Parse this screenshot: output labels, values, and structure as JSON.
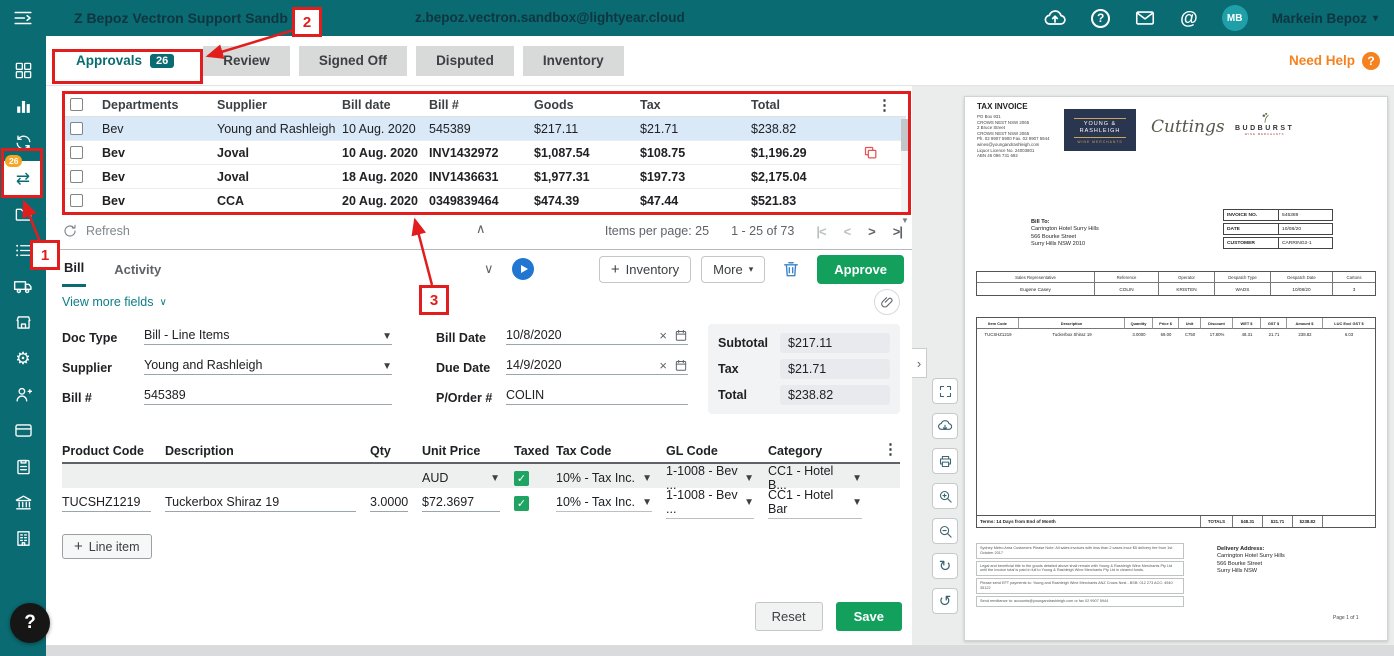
{
  "topbar": {
    "company": "Z Bepoz Vectron Support Sandb",
    "email": "z.bepoz.vectron.sandbox@lightyear.cloud",
    "user_initials": "MB",
    "user_name": "Markein Bepoz"
  },
  "sidebar": {
    "bills_badge": "26"
  },
  "tabs": {
    "approvals": "Approvals",
    "approvals_badge": "26",
    "review": "Review",
    "signed_off": "Signed Off",
    "disputed": "Disputed",
    "inventory": "Inventory",
    "need_help": "Need Help"
  },
  "bills": {
    "headers": {
      "departments": "Departments",
      "supplier": "Supplier",
      "bill_date": "Bill date",
      "bill_no": "Bill #",
      "goods": "Goods",
      "tax": "Tax",
      "total": "Total"
    },
    "rows": [
      {
        "department": "Bev",
        "supplier": "Young and Rashleigh",
        "bill_date": "10 Aug. 2020",
        "bill_no": "545389",
        "goods": "$217.11",
        "tax": "$21.71",
        "total": "$238.82"
      },
      {
        "department": "Bev",
        "supplier": "Joval",
        "bill_date": "10 Aug. 2020",
        "bill_no": "INV1432972",
        "goods": "$1,087.54",
        "tax": "$108.75",
        "total": "$1,196.29"
      },
      {
        "department": "Bev",
        "supplier": "Joval",
        "bill_date": "18 Aug. 2020",
        "bill_no": "INV1436631",
        "goods": "$1,977.31",
        "tax": "$197.73",
        "total": "$2,175.04"
      },
      {
        "department": "Bev",
        "supplier": "CCA",
        "bill_date": "20 Aug. 2020",
        "bill_no": "0349839464",
        "goods": "$474.39",
        "tax": "$47.44",
        "total": "$521.83"
      }
    ],
    "footer": {
      "refresh": "Refresh",
      "items_per_page": "Items per page: 25",
      "range": "1 - 25 of 73"
    }
  },
  "detail": {
    "tab_bill": "Bill",
    "tab_activity": "Activity",
    "inventory_button": "Inventory",
    "more_button": "More",
    "approve_button": "Approve",
    "view_more": "View more fields",
    "labels": {
      "doc_type": "Doc Type",
      "supplier": "Supplier",
      "bill_no": "Bill #",
      "bill_date": "Bill Date",
      "due_date": "Due Date",
      "p_order": "P/Order #"
    },
    "values": {
      "doc_type": "Bill - Line Items",
      "supplier": "Young and Rashleigh",
      "bill_no": "545389",
      "bill_date": "10/8/2020",
      "due_date": "14/9/2020",
      "p_order": "COLIN"
    },
    "summary": {
      "subtotal_label": "Subtotal",
      "subtotal": "$217.11",
      "tax_label": "Tax",
      "tax": "$21.71",
      "total_label": "Total",
      "total": "$238.82"
    },
    "items": {
      "headers": {
        "product_code": "Product Code",
        "description": "Description",
        "qty": "Qty",
        "unit_price": "Unit Price",
        "taxed": "Taxed",
        "tax_code": "Tax Code",
        "gl_code": "GL Code",
        "category": "Category"
      },
      "defaults": {
        "currency": "AUD",
        "tax_code": "10% - Tax Inc.",
        "gl_code": "1-1008 - Bev ...",
        "category": "CC1 - Hotel B..."
      },
      "row": {
        "product_code": "TUCSHZ1219",
        "description": "Tuckerbox Shiraz 19",
        "qty": "3.0000",
        "unit_price": "$72.3697",
        "tax_code": "10% - Tax Inc.",
        "gl_code": "1-1008 - Bev ...",
        "category": "CC1 - Hotel Bar"
      },
      "add_line": "Line item"
    },
    "reset_button": "Reset",
    "save_button": "Save"
  },
  "invoice": {
    "title": "TAX INVOICE",
    "sender_lines": [
      "PO Box 931",
      "CROWS NEST NSW 2065",
      "2 Bruce Street",
      "CROWS NEST NSW 2065",
      "Ph. 02 9907 5900 Fax. 02 9907 5944",
      "wines@youngandrashleigh.com",
      "Liquor Licence No. 24003801",
      "ABN 46 096 731 692"
    ],
    "logo_yr_1": "YOUNG &",
    "logo_yr_2": "RASHLEIGH",
    "logo_yr_sub": "WINE MERCHANTS",
    "logo_cuttings": "Cuttings",
    "logo_budburst": "BUDBURST",
    "logo_budburst_sub": "WINE MERCHANTS",
    "bill_to_label": "Bill To:",
    "bill_to": [
      "Carrington Hotel Surry Hills",
      "566 Bourke Street",
      "Surry Hills NSW 2010"
    ],
    "meta": {
      "invoice_no_label": "INVOICE NO.",
      "invoice_no": "545389",
      "date_label": "DATE",
      "date": "10/08/20",
      "customer_label": "CUSTOMER",
      "customer": "CARRING2-1"
    },
    "rep_headers": [
      "Sales Representative",
      "Reference",
      "Operator",
      "Despatch Type",
      "Despatch Date",
      "Cartons"
    ],
    "rep_values": [
      "Eugene Casey",
      "COLIN",
      "KRISTEN",
      "WADS",
      "10/08/20",
      "3"
    ],
    "item_headers": [
      "Item Code",
      "Description",
      "Quantity",
      "Price $",
      "Unit",
      "Discount",
      "WET $",
      "GST $",
      "Amount $",
      "LUC Excl GST $"
    ],
    "item_row": [
      "TUCSHZ1219",
      "Tuckerbox Shiraz 19",
      "3.0000",
      "69.00",
      "C750",
      "17.80%",
      "48.31",
      "21.71",
      "238.82",
      "6.03"
    ],
    "terms": "Terms: 14 Days from End of Month",
    "totals_label": "TOTALS",
    "totals": [
      "$48.31",
      "$21.71",
      "$238.82"
    ],
    "notes": [
      "Sydney Metro Area Customers Please Note: All sales invoices with less than 2 cases incur $5 delivery fee from 1st October 2017",
      "Legal and beneficial title to the goods detailed above shall remain with Young & Rashleigh Wine Merchants Pty Ltd until the invoice total is paid in full to Young & Rashleigh Wine Merchants Pty Ltd in cleared funds.",
      "Please send EFT payments to: Young and Rashleigh Wine Merchants ANZ Crows Nest - BSB: 012 273 ACC: 4940 35122",
      "Send remittance to: accounts@youngandrashleigh.com or fax 02 9907 5944"
    ],
    "delivery_label": "Delivery Address:",
    "delivery": [
      "Carrington Hotel Surry Hills",
      "566 Bourke Street",
      "Surry Hills NSW"
    ],
    "page": "Page 1 of 1"
  },
  "annotations": {
    "n1": "1",
    "n2": "2",
    "n3": "3"
  }
}
